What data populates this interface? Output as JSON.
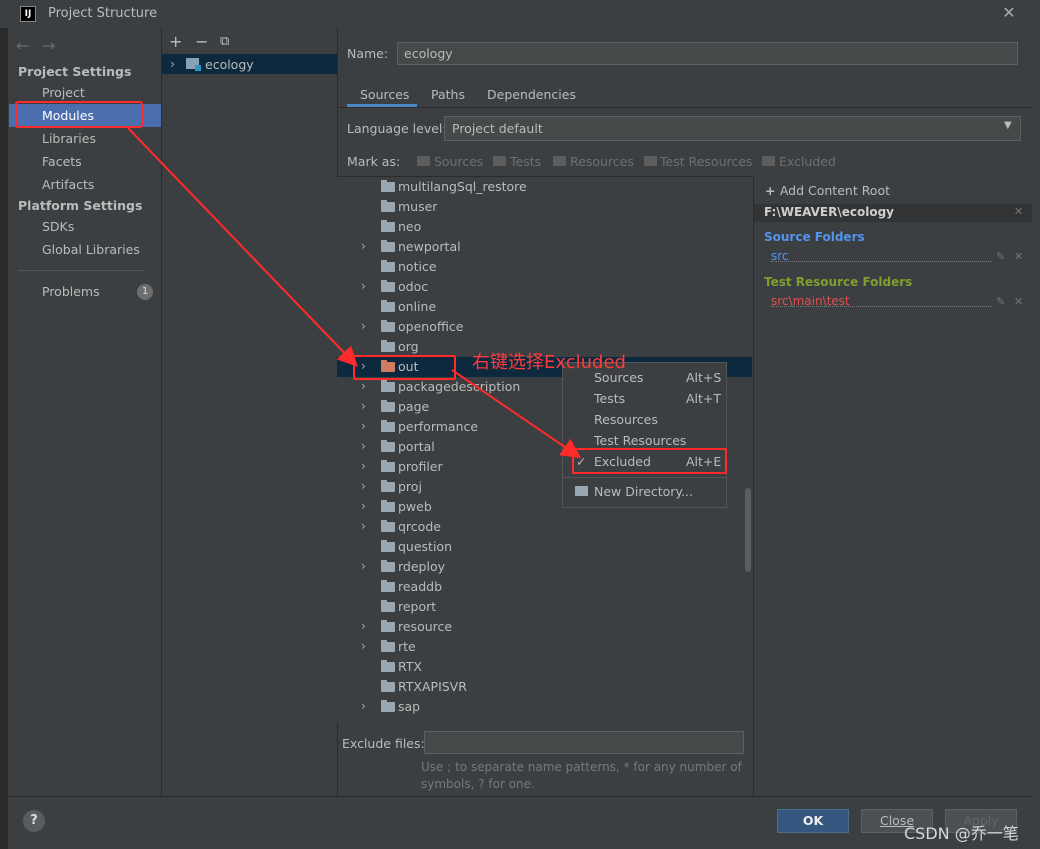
{
  "window": {
    "title": "Project Structure",
    "app_icon": "IJ"
  },
  "sidebar": {
    "heading_project": "Project Settings",
    "project_items": [
      "Project",
      "Modules",
      "Libraries",
      "Facets",
      "Artifacts"
    ],
    "heading_platform": "Platform Settings",
    "platform_items": [
      "SDKs",
      "Global Libraries"
    ],
    "problems": "Problems",
    "problems_count": "1",
    "selected": "Modules"
  },
  "modules": {
    "name": "ecology"
  },
  "details": {
    "name_label": "Name:",
    "name_value": "ecology",
    "tabs": [
      "Sources",
      "Paths",
      "Dependencies"
    ],
    "active_tab": "Sources",
    "language_level_label": "Language level:",
    "language_level_value": "Project default",
    "mark_as_label": "Mark as:",
    "mark_as": [
      "Sources",
      "Tests",
      "Resources",
      "Test Resources",
      "Excluded"
    ]
  },
  "tree": {
    "folders": [
      {
        "name": "multilangSql_restore",
        "expandable": false
      },
      {
        "name": "muser",
        "expandable": false
      },
      {
        "name": "neo",
        "expandable": false
      },
      {
        "name": "newportal",
        "expandable": true
      },
      {
        "name": "notice",
        "expandable": false
      },
      {
        "name": "odoc",
        "expandable": true
      },
      {
        "name": "online",
        "expandable": false
      },
      {
        "name": "openoffice",
        "expandable": true
      },
      {
        "name": "org",
        "expandable": false
      },
      {
        "name": "out",
        "expandable": true,
        "selected": true
      },
      {
        "name": "packagedescription",
        "expandable": true
      },
      {
        "name": "page",
        "expandable": true
      },
      {
        "name": "performance",
        "expandable": true
      },
      {
        "name": "portal",
        "expandable": true
      },
      {
        "name": "profiler",
        "expandable": true
      },
      {
        "name": "proj",
        "expandable": true
      },
      {
        "name": "pweb",
        "expandable": true
      },
      {
        "name": "qrcode",
        "expandable": true
      },
      {
        "name": "question",
        "expandable": false
      },
      {
        "name": "rdeploy",
        "expandable": true
      },
      {
        "name": "readdb",
        "expandable": false
      },
      {
        "name": "report",
        "expandable": false
      },
      {
        "name": "resource",
        "expandable": true
      },
      {
        "name": "rte",
        "expandable": true
      },
      {
        "name": "RTX",
        "expandable": false
      },
      {
        "name": "RTXAPISVR",
        "expandable": false
      },
      {
        "name": "sap",
        "expandable": true
      }
    ]
  },
  "content_root": {
    "add_label": "Add Content Root",
    "path": "F:\\WEAVER\\ecology",
    "source_folders_heading": "Source Folders",
    "source_folders": [
      "src"
    ],
    "test_resource_heading": "Test Resource Folders",
    "test_resource_folders": [
      "src\\main\\test"
    ]
  },
  "context_menu": {
    "items": [
      {
        "label": "Sources",
        "shortcut": "Alt+S"
      },
      {
        "label": "Tests",
        "shortcut": "Alt+T"
      },
      {
        "label": "Resources",
        "shortcut": ""
      },
      {
        "label": "Test Resources",
        "shortcut": ""
      },
      {
        "label": "Excluded",
        "shortcut": "Alt+E",
        "checked": true
      }
    ],
    "new_directory": "New Directory..."
  },
  "exclude": {
    "label": "Exclude files:",
    "value": "",
    "hint_line1": "Use ; to separate name patterns, * for any number of",
    "hint_line2": "symbols, ? for one."
  },
  "buttons": {
    "help": "?",
    "ok": "OK",
    "close": "Close",
    "apply": "Apply"
  },
  "annotation": {
    "text": "右键选择Excluded"
  },
  "watermark": "CSDN @乔一笔",
  "colors": {
    "background": "#3c3f41",
    "selection": "#4b6eaf",
    "tree_selection": "#0d293e",
    "source_blue": "#5394ec",
    "test_resource_green": "#7f9f2d",
    "annotation_red": "#ff2a2a"
  }
}
